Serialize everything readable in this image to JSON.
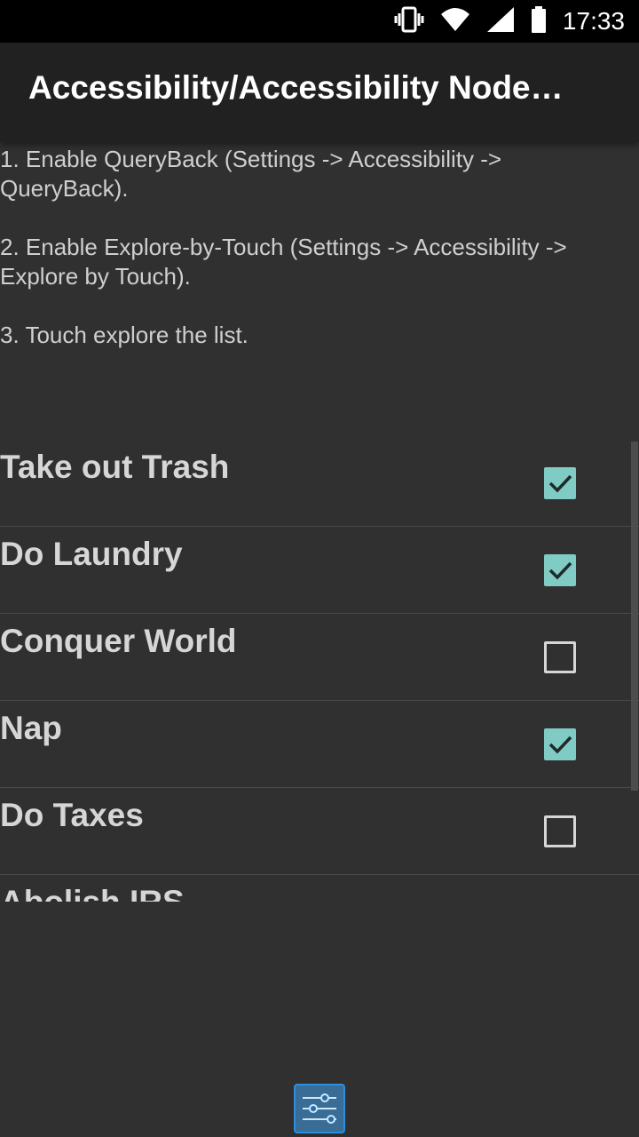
{
  "status_bar": {
    "time": "17:33",
    "icons": [
      "vibrate-icon",
      "wifi-icon",
      "signal-icon",
      "battery-icon"
    ]
  },
  "action_bar": {
    "title": "Accessibility/Accessibility Node…"
  },
  "instructions": [
    "1. Enable QueryBack (Settings -> Accessibility -> QueryBack).",
    "2. Enable Explore-by-Touch (Settings -> Accessibility -> Explore by Touch).",
    "3. Touch explore the list."
  ],
  "tasks": [
    {
      "label": "Take out Trash",
      "checked": true
    },
    {
      "label": "Do Laundry",
      "checked": true
    },
    {
      "label": "Conquer World",
      "checked": false
    },
    {
      "label": "Nap",
      "checked": true
    },
    {
      "label": "Do Taxes",
      "checked": false
    },
    {
      "label": "Abolish IRS",
      "checked": false
    }
  ],
  "colors": {
    "background": "#303030",
    "action_bar": "#212121",
    "checkbox_accent": "#80cbc4",
    "menu_button": "#2b8ee0"
  },
  "bottom": {
    "menu_icon": "settings-sliders-icon"
  }
}
